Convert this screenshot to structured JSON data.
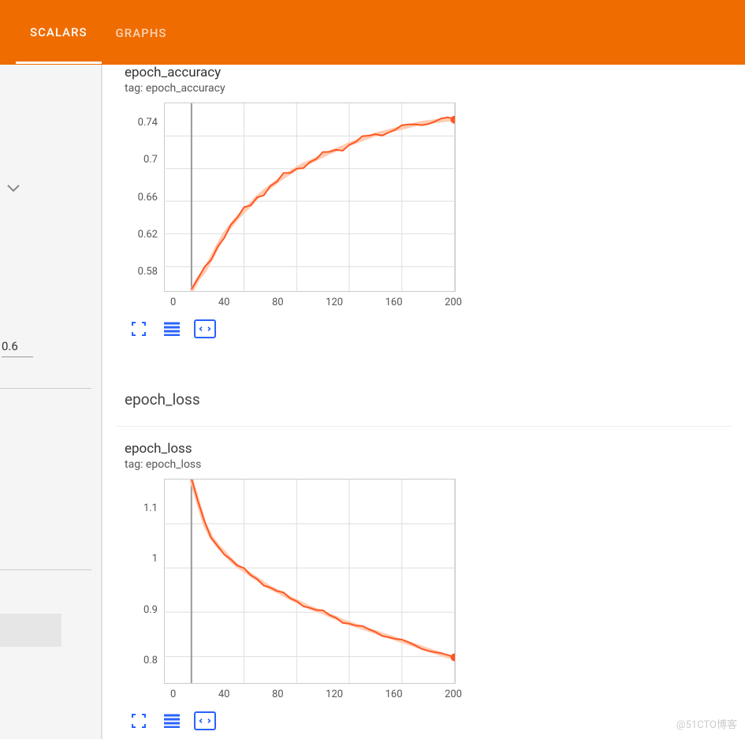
{
  "header": {
    "tabs": [
      {
        "label": "SCALARS",
        "active": true
      },
      {
        "label": "GRAPHS",
        "active": false
      }
    ]
  },
  "sidebar": {
    "smoothing_value": "0.6"
  },
  "section_loss_title": "epoch_loss",
  "charts": {
    "accuracy": {
      "title": "epoch_accuracy",
      "tag": "tag: epoch_accuracy",
      "yticks": [
        "0.74",
        "0.7",
        "0.66",
        "0.62",
        "0.58"
      ],
      "xticks": [
        "0",
        "40",
        "80",
        "120",
        "160",
        "200"
      ]
    },
    "loss": {
      "title": "epoch_loss",
      "tag": "tag: epoch_loss",
      "yticks": [
        "1.1",
        "1",
        "0.9",
        "0.8"
      ],
      "xticks": [
        "0",
        "40",
        "80",
        "120",
        "160",
        "200"
      ]
    }
  },
  "chart_data": [
    {
      "type": "line",
      "title": "epoch_accuracy",
      "xlabel": "",
      "ylabel": "",
      "xlim": [
        -20,
        200
      ],
      "ylim": [
        0.55,
        0.78
      ],
      "series": [
        {
          "name": "epoch_accuracy",
          "x": [
            0,
            5,
            10,
            15,
            20,
            25,
            30,
            35,
            40,
            45,
            50,
            55,
            60,
            65,
            70,
            75,
            80,
            85,
            90,
            95,
            100,
            105,
            110,
            115,
            120,
            125,
            130,
            135,
            140,
            145,
            150,
            155,
            160,
            165,
            170,
            175,
            180,
            185,
            190,
            195,
            200
          ],
          "y": [
            0.55,
            0.565,
            0.575,
            0.59,
            0.605,
            0.62,
            0.63,
            0.64,
            0.648,
            0.656,
            0.665,
            0.672,
            0.678,
            0.684,
            0.69,
            0.695,
            0.7,
            0.705,
            0.708,
            0.712,
            0.716,
            0.72,
            0.723,
            0.726,
            0.73,
            0.733,
            0.736,
            0.739,
            0.742,
            0.744,
            0.746,
            0.748,
            0.75,
            0.752,
            0.754,
            0.756,
            0.757,
            0.758,
            0.759,
            0.76,
            0.76
          ]
        }
      ]
    },
    {
      "type": "line",
      "title": "epoch_loss",
      "xlabel": "",
      "ylabel": "",
      "xlim": [
        -20,
        200
      ],
      "ylim": [
        0.74,
        1.2
      ],
      "series": [
        {
          "name": "epoch_loss",
          "x": [
            0,
            5,
            10,
            15,
            20,
            25,
            30,
            35,
            40,
            45,
            50,
            55,
            60,
            65,
            70,
            75,
            80,
            85,
            90,
            95,
            100,
            105,
            110,
            115,
            120,
            125,
            130,
            135,
            140,
            145,
            150,
            155,
            160,
            165,
            170,
            175,
            180,
            185,
            190,
            195,
            200
          ],
          "y": [
            1.2,
            1.15,
            1.1,
            1.07,
            1.05,
            1.035,
            1.018,
            1.005,
            0.995,
            0.985,
            0.975,
            0.965,
            0.955,
            0.948,
            0.94,
            0.932,
            0.925,
            0.918,
            0.91,
            0.905,
            0.9,
            0.893,
            0.887,
            0.88,
            0.875,
            0.87,
            0.865,
            0.86,
            0.855,
            0.85,
            0.845,
            0.84,
            0.835,
            0.83,
            0.825,
            0.82,
            0.815,
            0.81,
            0.805,
            0.8,
            0.798
          ]
        }
      ]
    }
  ],
  "watermark": "@51CTO博客"
}
